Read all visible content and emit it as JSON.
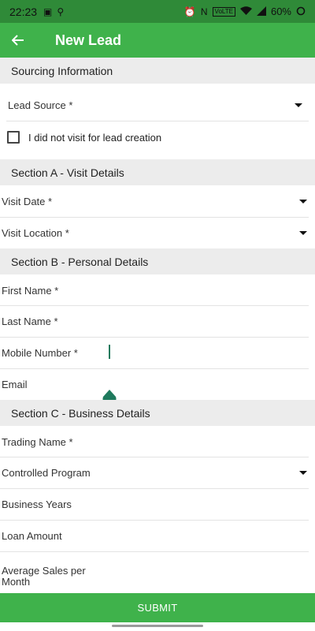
{
  "status_bar": {
    "time": "22:23",
    "volte": "VoLTE",
    "battery": "60%"
  },
  "app_bar": {
    "title": "New Lead",
    "back_icon": "arrow-left-icon"
  },
  "sourcing": {
    "header": "Sourcing Information",
    "lead_source": "Lead Source *",
    "no_visit_checkbox": "I did not visit for lead creation",
    "no_visit_checked": false
  },
  "section_a": {
    "header": "Section A - Visit Details",
    "visit_date": "Visit Date *",
    "visit_location": "Visit Location *"
  },
  "section_b": {
    "header": "Section B - Personal Details",
    "first_name": "First Name *",
    "last_name": "Last Name *",
    "mobile_number": "Mobile Number *",
    "email": "Email"
  },
  "section_c": {
    "header": "Section C - Business Details",
    "trading_name": "Trading Name *",
    "controlled_program": "Controlled Program",
    "business_years": "Business Years",
    "loan_amount": "Loan Amount",
    "average_sales_line1": "Average Sales per",
    "average_sales_line2": "Month"
  },
  "submit_label": "SUBMIT",
  "colors": {
    "status_bar": "#2f8a38",
    "primary": "#3fb24b",
    "section_bg": "#ececec",
    "accent": "#1f7a5d"
  }
}
